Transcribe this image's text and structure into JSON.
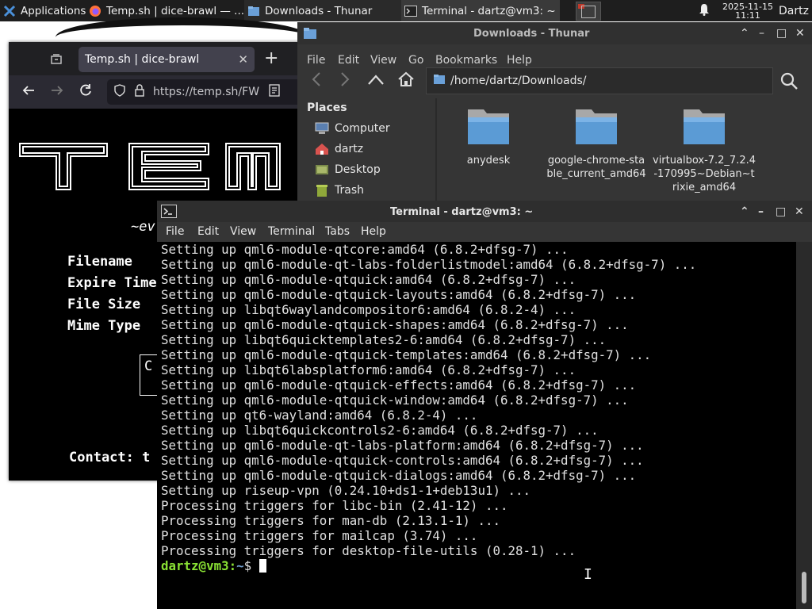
{
  "taskbar": {
    "apps_label": "Applications",
    "tasks": [
      {
        "label": "Temp.sh | dice-brawl — ..."
      },
      {
        "label": "Downloads - Thunar"
      },
      {
        "label": "Terminal - dartz@vm3: ~"
      }
    ],
    "date": "2025-11-15",
    "time": "11:11",
    "user": "Dartz"
  },
  "firefox": {
    "tab_title": "Temp.sh | dice-brawl",
    "url": "https://temp.sh/FW",
    "logo_text": "TEM",
    "tagline": "~ev",
    "fields": [
      "Filename",
      "Expire Time",
      "File Size",
      "Mime Type"
    ],
    "button_fragment": "C",
    "contact": "Contact: t"
  },
  "thunar": {
    "title": "Downloads - Thunar",
    "menu": [
      "File",
      "Edit",
      "View",
      "Go",
      "Bookmarks",
      "Help"
    ],
    "path": "/home/dartz/Downloads/",
    "places_heading": "Places",
    "places": [
      "Computer",
      "dartz",
      "Desktop",
      "Trash"
    ],
    "files": [
      {
        "name": "anydesk"
      },
      {
        "name": "google-chrome-stable_current_amd64"
      },
      {
        "name": "virtualbox-7.2_7.2.4-170995~Debian~trixie_amd64"
      }
    ]
  },
  "terminal": {
    "title": "Terminal - dartz@vm3: ~",
    "menu": [
      "File",
      "Edit",
      "View",
      "Terminal",
      "Tabs",
      "Help"
    ],
    "lines": [
      "Setting up qml6-module-qtcore:amd64 (6.8.2+dfsg-7) ...",
      "Setting up qml6-module-qt-labs-folderlistmodel:amd64 (6.8.2+dfsg-7) ...",
      "Setting up qml6-module-qtquick:amd64 (6.8.2+dfsg-7) ...",
      "Setting up qml6-module-qtquick-layouts:amd64 (6.8.2+dfsg-7) ...",
      "Setting up libqt6waylandcompositor6:amd64 (6.8.2-4) ...",
      "Setting up qml6-module-qtquick-shapes:amd64 (6.8.2+dfsg-7) ...",
      "Setting up libqt6quicktemplates2-6:amd64 (6.8.2+dfsg-7) ...",
      "Setting up qml6-module-qtquick-templates:amd64 (6.8.2+dfsg-7) ...",
      "Setting up libqt6labsplatform6:amd64 (6.8.2+dfsg-7) ...",
      "Setting up qml6-module-qtquick-effects:amd64 (6.8.2+dfsg-7) ...",
      "Setting up qml6-module-qtquick-window:amd64 (6.8.2+dfsg-7) ...",
      "Setting up qt6-wayland:amd64 (6.8.2-4) ...",
      "Setting up libqt6quickcontrols2-6:amd64 (6.8.2+dfsg-7) ...",
      "Setting up qml6-module-qt-labs-platform:amd64 (6.8.2+dfsg-7) ...",
      "Setting up qml6-module-qtquick-controls:amd64 (6.8.2+dfsg-7) ...",
      "Setting up qml6-module-qtquick-dialogs:amd64 (6.8.2+dfsg-7) ...",
      "Setting up riseup-vpn (0.24.10+ds1-1+deb13u1) ...",
      "Processing triggers for libc-bin (2.41-12) ...",
      "Processing triggers for man-db (2.13.1-1) ...",
      "Processing triggers for mailcap (3.74) ...",
      "Processing triggers for desktop-file-utils (0.28-1) ..."
    ],
    "prompt_user": "dartz@vm3",
    "prompt_sep": ":",
    "prompt_path": "~",
    "prompt_sym": "$"
  },
  "colors": {
    "prompt_green": "#8ae234",
    "prompt_blue": "#729fcf",
    "folder_blue": "#5b9bd5"
  }
}
